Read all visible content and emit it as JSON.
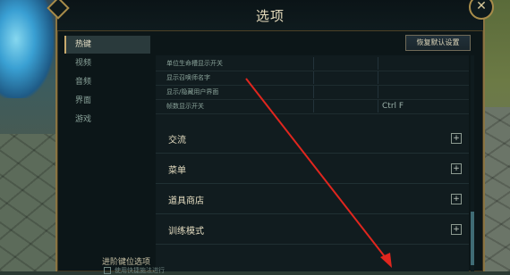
{
  "dialog": {
    "title": "选项",
    "close_icon": "close-icon",
    "restore_defaults_label": "恢复默认设置"
  },
  "sidebar": {
    "items": [
      {
        "label": "热键",
        "active": true
      },
      {
        "label": "视频",
        "active": false
      },
      {
        "label": "音频",
        "active": false
      },
      {
        "label": "界面",
        "active": false
      },
      {
        "label": "游戏",
        "active": false
      }
    ]
  },
  "hotkeys": [
    {
      "label": "单位生命槽显示开关",
      "key1": "",
      "key2": ""
    },
    {
      "label": "显示召唤师名字",
      "key1": "",
      "key2": ""
    },
    {
      "label": "显示/隐藏用户界面",
      "key1": "",
      "key2": ""
    },
    {
      "label": "帧数显示开关",
      "key1": "",
      "key2": "Ctrl  F"
    }
  ],
  "sections": [
    {
      "label": "交流",
      "icon": "plus-icon"
    },
    {
      "label": "菜单",
      "icon": "plus-icon"
    },
    {
      "label": "道具商店",
      "icon": "plus-icon"
    },
    {
      "label": "训练模式",
      "icon": "plus-icon"
    }
  ],
  "advanced": {
    "title": "进阶键位选项",
    "sub": "使用快捷施法进行"
  },
  "colors": {
    "accent_gold": "#c8aa6e",
    "annotation_red": "#e0261e",
    "panel_bg": "#111c1f"
  }
}
